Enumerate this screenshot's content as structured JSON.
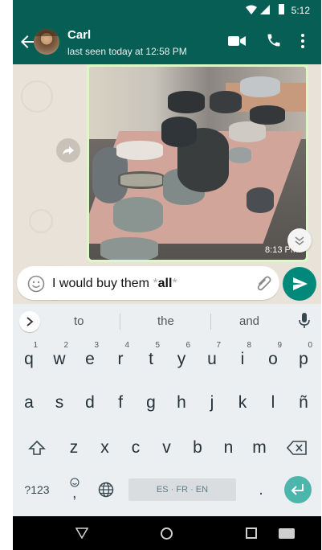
{
  "status_bar": {
    "time": "5:12"
  },
  "header": {
    "contact_name": "Carl",
    "last_seen": "last seen today at 12:58 PM"
  },
  "chat": {
    "image_message": {
      "timestamp": "8:13 PM"
    }
  },
  "composer": {
    "text_prefix": "I would buy them ",
    "fmt_open": "*",
    "bold_word": "all",
    "fmt_close": "*"
  },
  "keyboard": {
    "suggestions": [
      "to",
      "the",
      "and"
    ],
    "row1": [
      {
        "k": "q",
        "n": "1"
      },
      {
        "k": "w",
        "n": "2"
      },
      {
        "k": "e",
        "n": "3"
      },
      {
        "k": "r",
        "n": "4"
      },
      {
        "k": "t",
        "n": "5"
      },
      {
        "k": "y",
        "n": "6"
      },
      {
        "k": "u",
        "n": "7"
      },
      {
        "k": "i",
        "n": "8"
      },
      {
        "k": "o",
        "n": "9"
      },
      {
        "k": "p",
        "n": "0"
      }
    ],
    "row2": [
      "a",
      "s",
      "d",
      "f",
      "g",
      "h",
      "j",
      "k",
      "l",
      "ñ"
    ],
    "row3": [
      "z",
      "x",
      "c",
      "v",
      "b",
      "n",
      "m"
    ],
    "symbols_label": "?123",
    "comma_label": ",",
    "period_label": ".",
    "space_label": "ES · FR · EN"
  },
  "colors": {
    "header_green": "#075e54",
    "send_teal": "#00897b",
    "outgoing_bubble": "#dcf8c6",
    "enter_key": "#4db6ac"
  },
  "icons": [
    "back-arrow-icon",
    "video-call-icon",
    "phone-icon",
    "more-vert-icon",
    "forward-icon",
    "emoji-icon",
    "attach-icon",
    "send-icon",
    "chevron-right-icon",
    "mic-icon",
    "shift-icon",
    "backspace-icon",
    "globe-icon",
    "enter-icon",
    "scroll-down-icon"
  ]
}
